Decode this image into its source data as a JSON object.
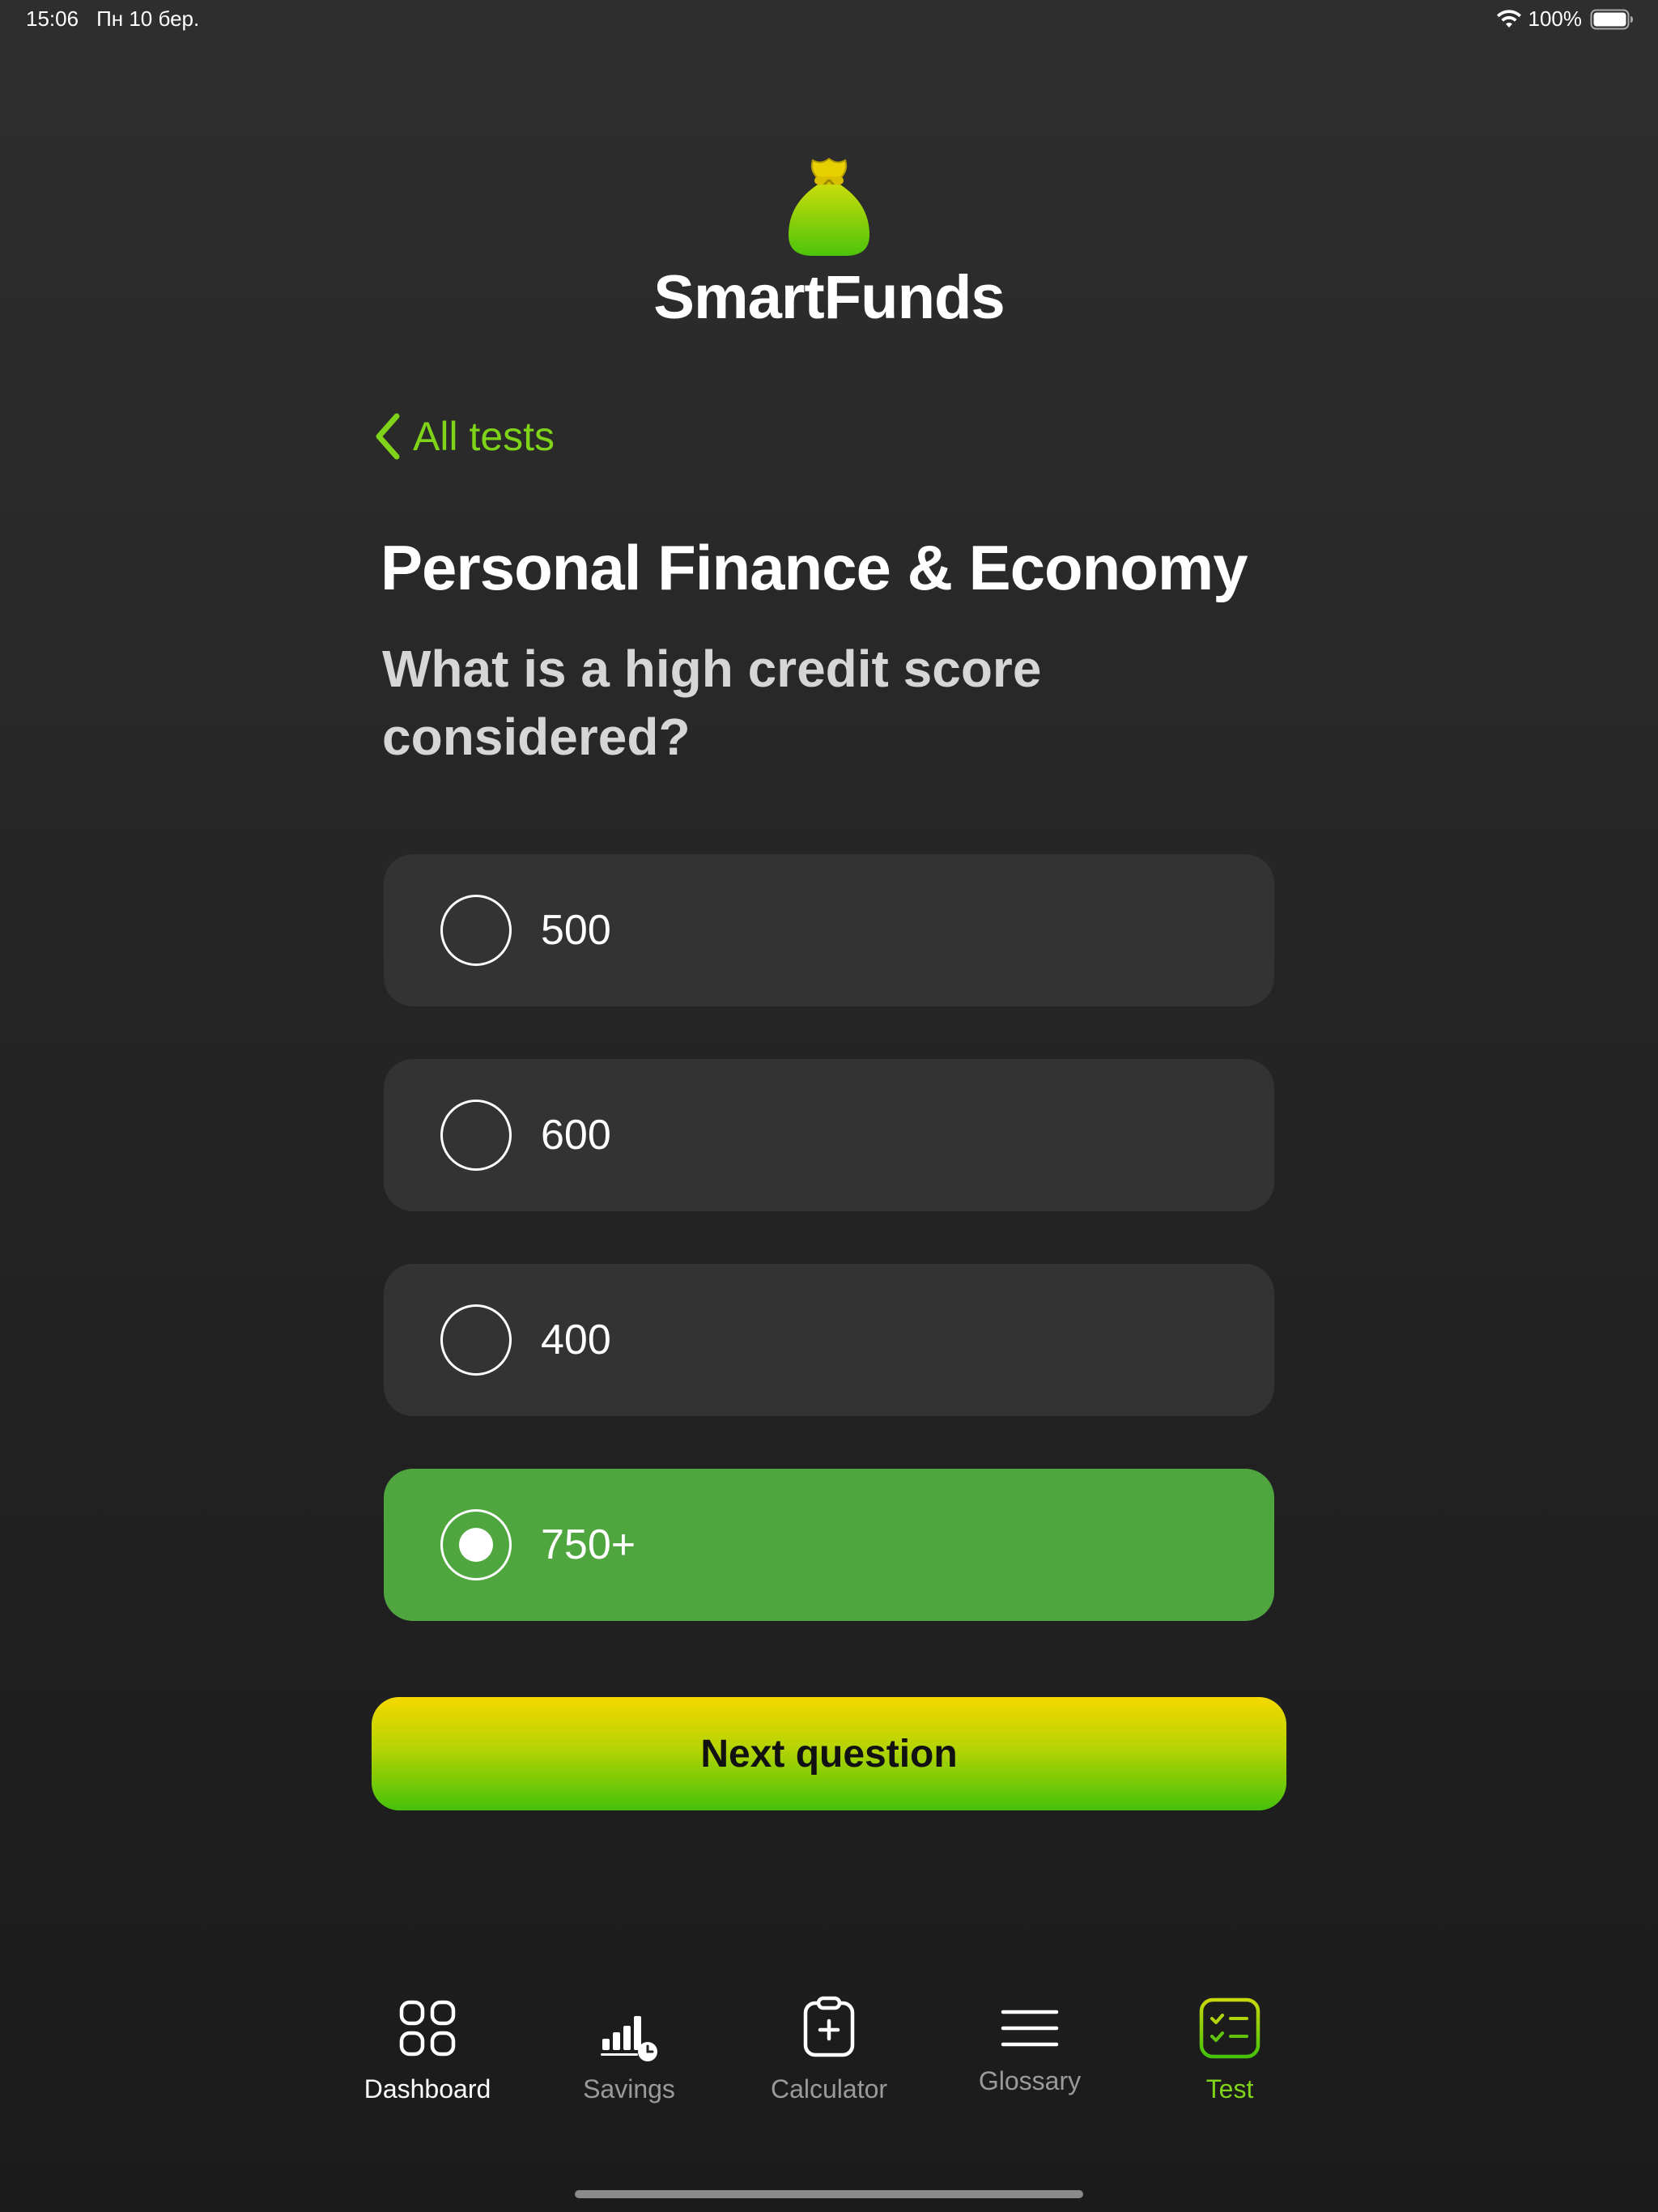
{
  "status_bar": {
    "time": "15:06",
    "date": "Пн 10 бер.",
    "battery": "100%"
  },
  "app": {
    "title": "SmartFunds",
    "logo_icon": "money-bag-icon"
  },
  "back_link": {
    "label": "All tests",
    "icon": "chevron-left-icon"
  },
  "test": {
    "title": "Personal Finance & Economy",
    "question": "What is a high credit score considered?",
    "answers": [
      {
        "label": "500",
        "selected": false
      },
      {
        "label": "600",
        "selected": false
      },
      {
        "label": "400",
        "selected": false
      },
      {
        "label": "750+",
        "selected": true
      }
    ],
    "next_label": "Next question"
  },
  "tab_bar": {
    "items": [
      {
        "label": "Dashboard",
        "icon": "dashboard-grid-icon"
      },
      {
        "label": "Savings",
        "icon": "savings-chart-icon"
      },
      {
        "label": "Calculator",
        "icon": "clipboard-plus-icon"
      },
      {
        "label": "Glossary",
        "icon": "menu-lines-icon"
      },
      {
        "label": "Test",
        "icon": "checklist-icon"
      }
    ],
    "active": "Test"
  },
  "colors": {
    "accent_green": "#7fd318",
    "selected_answer": "#4fa63f",
    "answer_bg": "#333333",
    "button_gradient_top": "#f5d800",
    "button_gradient_bottom": "#46c10a"
  }
}
